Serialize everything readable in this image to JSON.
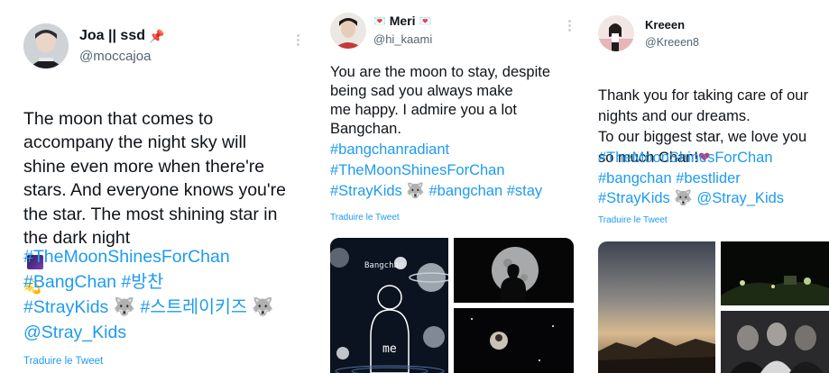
{
  "tweets": [
    {
      "name": "Joa || ssd",
      "handle": "@moccajoa",
      "text": "The moon that comes to\naccompany the night sky will\nshine even more when there're\nstars. And everyone knows you're\nthe star.  The most shining star in\nthe dark night",
      "hashtags": "#TheMoonShinesForChan\n#BangChan #방찬\n#StrayKids 🐺 #스트레이키즈 🐺\n@Stray_Kids",
      "translate": "Traduire le Tweet"
    },
    {
      "name": "Meri",
      "handle": "@hi_kaami",
      "text": "You are the moon to stay, despite\nbeing sad you always make\nme happy. I admire you a lot\nBangchan.",
      "hashtags": "#bangchanradiant\n #TheMoonShinesForChan\n#StrayKids 🐺  #bangchan #stay",
      "translate": "Traduire le Tweet",
      "image_text_1": "Bangchan",
      "image_text_2": "me"
    },
    {
      "name": "Kreeen",
      "handle": "@Kreeen8",
      "text": "Thank you for taking care of our\nnights and our dreams.\nTo our biggest star, we love you\nso much Chan!",
      "hashtags": "#TheMoonShinesForChan\n#bangchan #bestlider\n#StrayKids 🐺  @Stray_Kids",
      "translate": "Traduire le Tweet"
    }
  ],
  "colors": {
    "link": "#1d9bf0",
    "text": "#0f1419",
    "muted": "#536471"
  }
}
